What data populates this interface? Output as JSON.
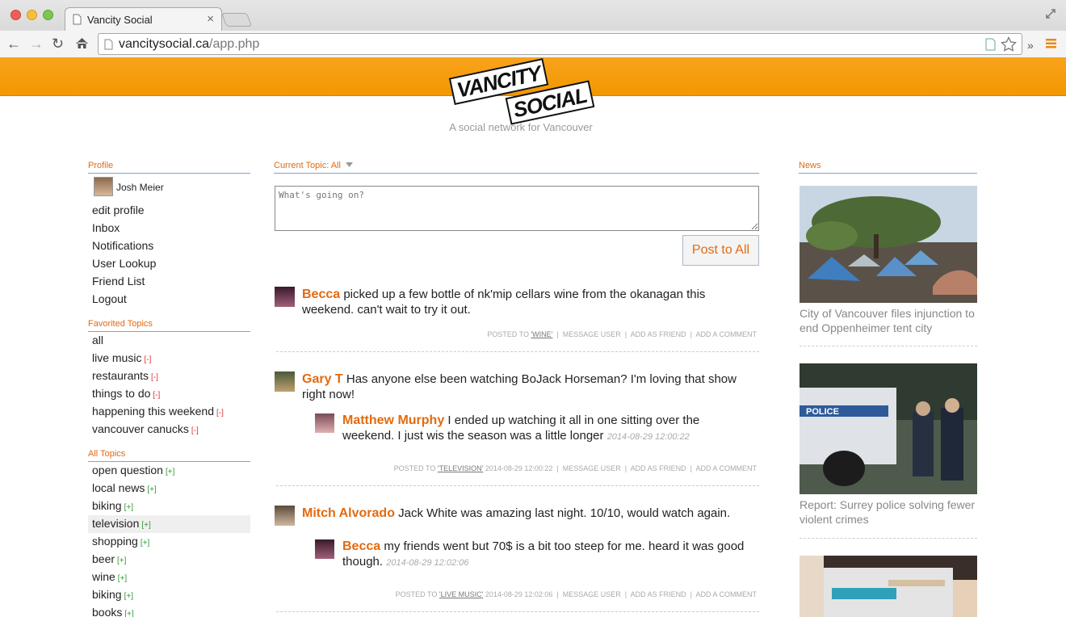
{
  "browser": {
    "tab_title": "Vancity Social",
    "tab_close": "×",
    "url_host": "vancitysocial.ca",
    "url_path": "/app.php"
  },
  "site": {
    "logo_line1": "VANCITY",
    "logo_line2": "SOCIAL",
    "tagline": "A social network for Vancouver",
    "accent_color": "#f39700",
    "link_color": "#e36a10"
  },
  "profile": {
    "heading": "Profile",
    "user_name": "Josh Meier",
    "links": [
      "edit profile",
      "Inbox",
      "Notifications",
      "User Lookup",
      "Friend List",
      "Logout"
    ]
  },
  "favorited_topics": {
    "heading": "Favorited Topics",
    "items": [
      {
        "label": "all",
        "action": ""
      },
      {
        "label": "live music",
        "action": "[-]"
      },
      {
        "label": "restaurants",
        "action": "[-]"
      },
      {
        "label": "things to do",
        "action": "[-]"
      },
      {
        "label": "happening this weekend",
        "action": "[-]"
      },
      {
        "label": "vancouver canucks",
        "action": "[-]"
      }
    ]
  },
  "all_topics": {
    "heading": "All Topics",
    "items": [
      {
        "label": "open question",
        "action": "[+]"
      },
      {
        "label": "local news",
        "action": "[+]"
      },
      {
        "label": "biking",
        "action": "[+]"
      },
      {
        "label": "television",
        "action": "[+]"
      },
      {
        "label": "shopping",
        "action": "[+]"
      },
      {
        "label": "beer",
        "action": "[+]"
      },
      {
        "label": "wine",
        "action": "[+]"
      },
      {
        "label": "biking",
        "action": "[+]"
      },
      {
        "label": "books",
        "action": "[+]"
      }
    ]
  },
  "feed": {
    "current_topic": "Current Topic: All",
    "compose_placeholder": "What's going on?",
    "post_button": "Post to All",
    "actions": [
      "MESSAGE USER",
      "ADD AS FRIEND",
      "ADD A COMMENT"
    ],
    "posts": [
      {
        "author": "Becca",
        "text": "picked up a few bottle of nk'mip cellars wine from the okanagan this weekend. can't wait to try it out.",
        "posted_to": "POSTED TO",
        "topic": "'WINE'",
        "timestamp": ""
      },
      {
        "author": "Gary T",
        "text": "Has anyone else been watching BoJack Horseman? I'm loving that show right now!",
        "posted_to": "POSTED TO",
        "topic": "'TELEVISION'",
        "timestamp": "2014-08-29 12:00:22",
        "reply": {
          "author": "Matthew Murphy",
          "text": "I ended up watching it all in one sitting over the weekend. I just wis the season was a little longer",
          "timestamp": "2014-08-29 12:00:22"
        }
      },
      {
        "author": "Mitch Alvorado",
        "text": "Jack White was amazing last night. 10/10, would watch again.",
        "posted_to": "POSTED TO",
        "topic": "'LIVE MUSIC'",
        "timestamp": "2014-08-29 12:02:06",
        "reply": {
          "author": "Becca",
          "text": "my friends went but 70$ is a bit too steep for me. heard it was good though.",
          "timestamp": "2014-08-29 12:02:06"
        }
      }
    ]
  },
  "news": {
    "heading": "News",
    "items": [
      {
        "caption": "City of Vancouver files injunction to end Oppenheimer tent city",
        "image": "tent-city-photo"
      },
      {
        "caption": "Report: Surrey police solving fewer violent crimes",
        "image": "police-photo"
      },
      {
        "caption": "",
        "image": "needles-photo"
      }
    ]
  }
}
